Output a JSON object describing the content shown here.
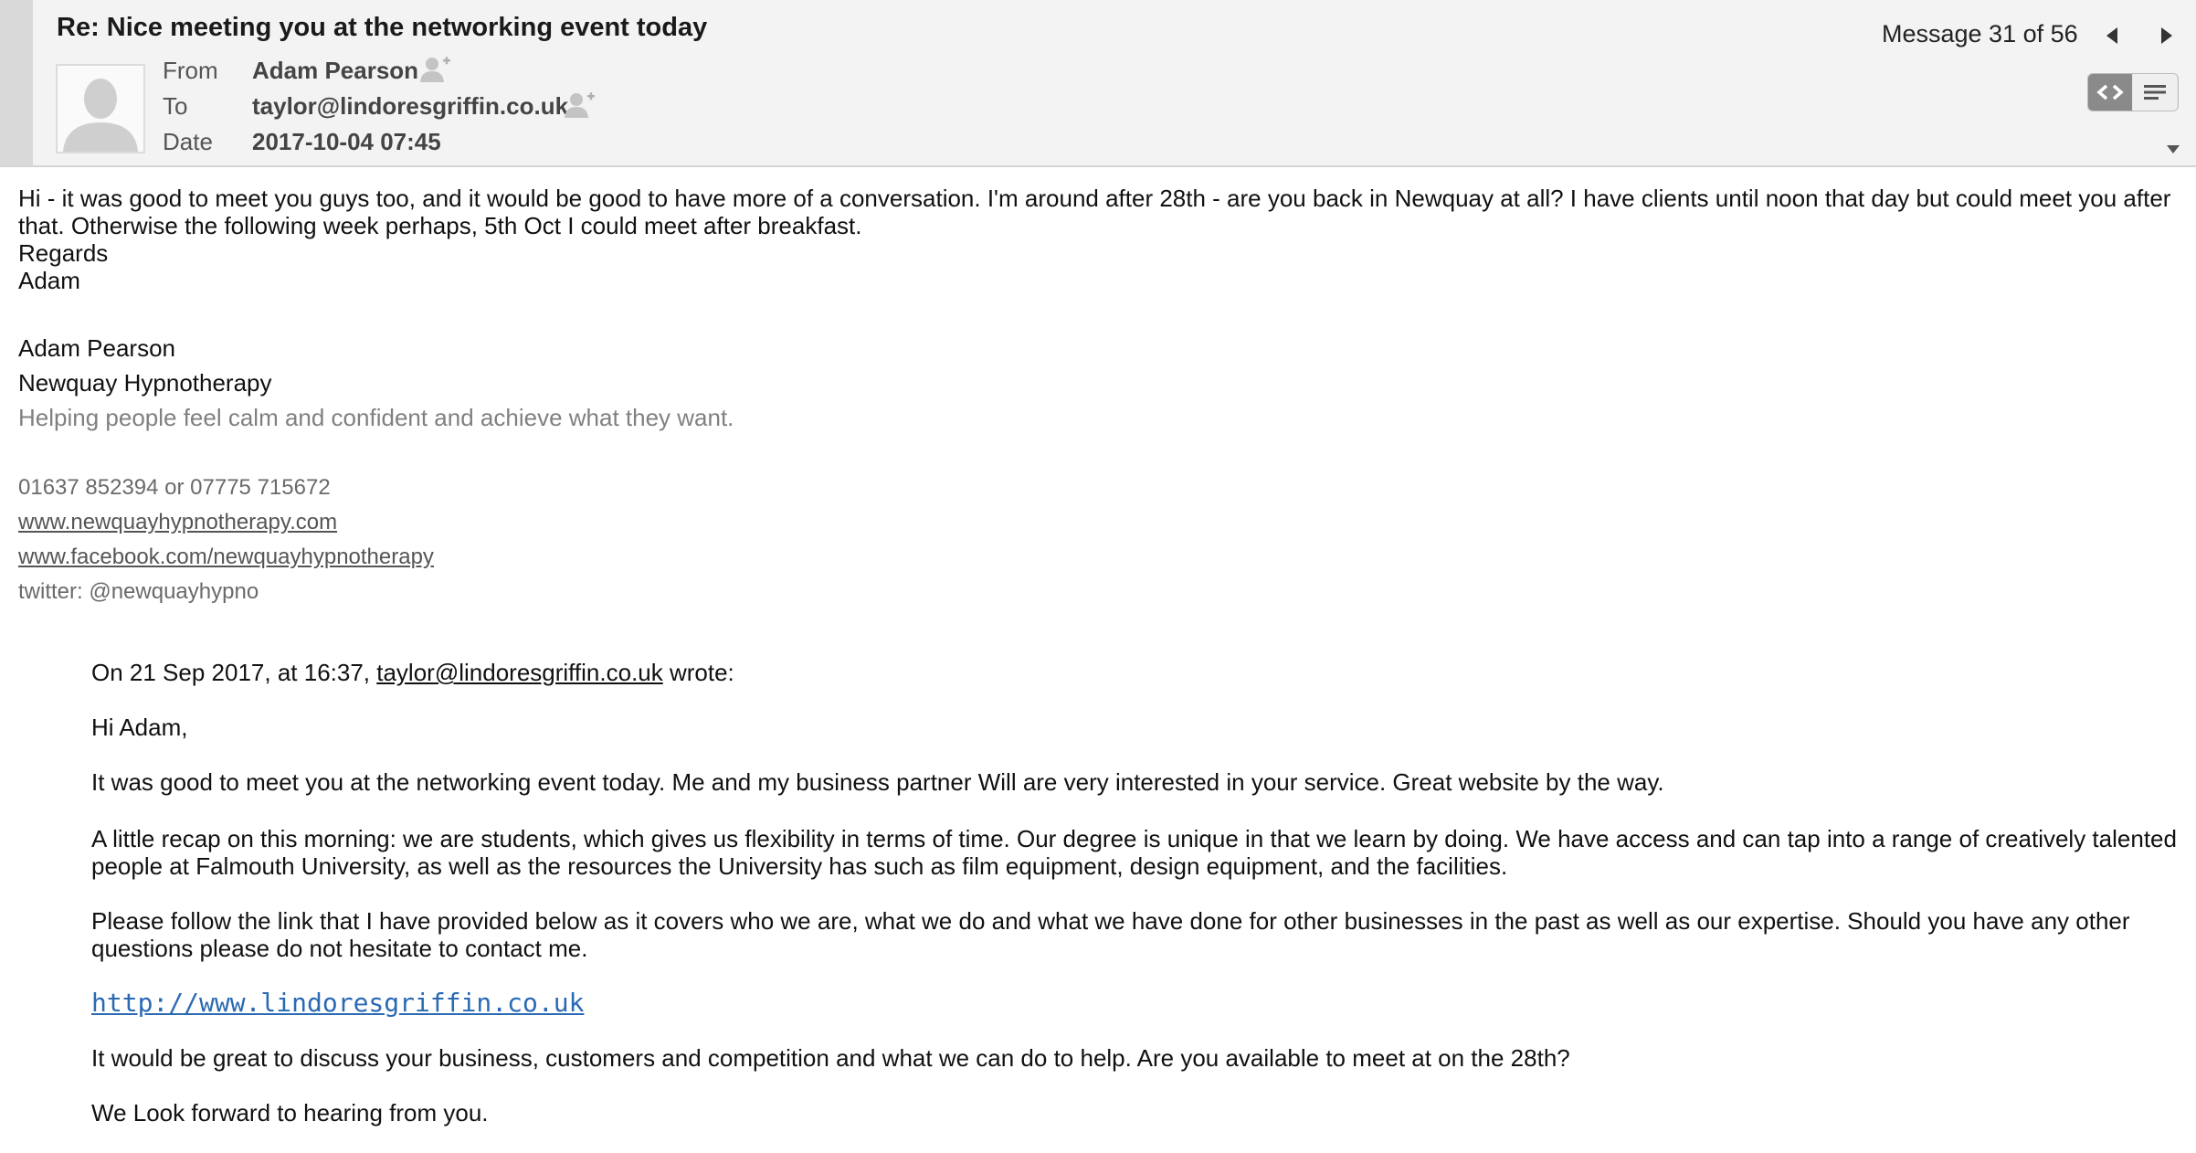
{
  "header": {
    "subject": "Re: Nice meeting you at the networking event today",
    "from_label": "From",
    "from_value": "Adam Pearson",
    "to_label": "To",
    "to_value": "taylor@lindoresgriffin.co.uk",
    "date_label": "Date",
    "date_value": "2017-10-04 07:45",
    "message_counter": "Message 31 of 56"
  },
  "body": {
    "paragraph": "Hi - it was good to meet you guys too, and it would be good to have more of a conversation.  I'm around after 28th - are you back in Newquay at all?  I have clients until noon that day but could meet you after that.  Otherwise the following week perhaps, 5th Oct I could meet after breakfast.",
    "regards": "Regards",
    "signoff": "Adam"
  },
  "signature": {
    "name": "Adam Pearson",
    "company": "Newquay Hypnotherapy",
    "tagline": "Helping people feel calm and confident and achieve what they want.",
    "phones": "01637 852394 or 07775 715672",
    "website": "www.newquayhypnotherapy.com",
    "facebook": "www.facebook.com/newquayhypnotherapy",
    "twitter": "twitter: @newquayhypno"
  },
  "quoted": {
    "intro_prefix": "On 21 Sep 2017, at 16:37, ",
    "intro_email": "taylor@lindoresgriffin.co.uk",
    "intro_suffix": " wrote:",
    "greeting": "Hi Adam,",
    "p1": "It was good to meet you at the networking event today. Me and my business partner Will are very interested in your service. Great website by the way.",
    "p2": "A little recap on this morning: we are students, which gives us flexibility in terms of time. Our degree is unique in that we learn by doing. We have access and can tap into a range of creatively talented people at Falmouth University, as well as the resources the University has such as film equipment, design equipment, and the facilities.",
    "p3": "Please follow the link that I have provided below as it covers who we are, what we do and what we have done for other businesses in the past as well as our expertise. Should you have any other questions please do not hesitate to contact me.",
    "link": "http://www.lindoresgriffin.co.uk",
    "p4": "It would be great to discuss your business, customers and competition and what we can do to help. Are you available to meet at on the 28th?",
    "p5": "We Look forward to hearing from you."
  },
  "icons": {
    "avatar": "person-silhouette-icon",
    "add_contact": "add-contact-icon",
    "prev": "triangle-left-icon",
    "next": "triangle-right-icon",
    "html_view": "code-icon",
    "plain_view": "lines-icon",
    "collapse": "triangle-down-icon"
  },
  "colors": {
    "header_bg": "#f3f3f3",
    "link_blue": "#2a6ab3",
    "toggle_active": "#8a8a8a"
  }
}
